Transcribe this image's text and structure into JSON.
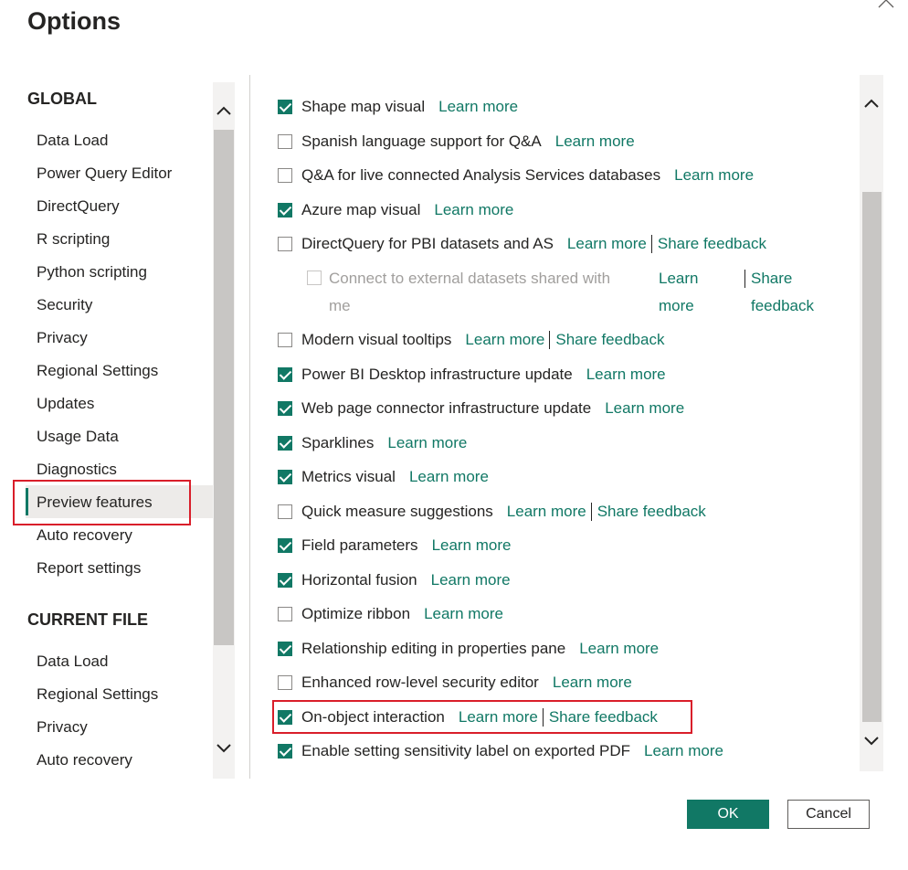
{
  "dialog": {
    "title": "Options"
  },
  "nav": {
    "global_heading": "GLOBAL",
    "global_items": [
      "Data Load",
      "Power Query Editor",
      "DirectQuery",
      "R scripting",
      "Python scripting",
      "Security",
      "Privacy",
      "Regional Settings",
      "Updates",
      "Usage Data",
      "Diagnostics",
      "Preview features",
      "Auto recovery",
      "Report settings"
    ],
    "current_heading": "CURRENT FILE",
    "current_items": [
      "Data Load",
      "Regional Settings",
      "Privacy",
      "Auto recovery"
    ],
    "selected": "Preview features"
  },
  "features": [
    {
      "label": "Shape map visual",
      "checked": true,
      "learn": "Learn more"
    },
    {
      "label": "Spanish language support for Q&A",
      "checked": false,
      "learn": "Learn more"
    },
    {
      "label": "Q&A for live connected Analysis Services databases",
      "checked": false,
      "learn": "Learn more"
    },
    {
      "label": "Azure map visual",
      "checked": true,
      "learn": "Learn more"
    },
    {
      "label": "DirectQuery for PBI datasets and AS",
      "checked": false,
      "learn": "Learn more",
      "feedback": "Share feedback"
    },
    {
      "label": "Modern visual tooltips",
      "checked": false,
      "learn": "Learn more",
      "feedback": "Share feedback"
    },
    {
      "label": "Power BI Desktop infrastructure update",
      "checked": true,
      "learn": "Learn more"
    },
    {
      "label": "Web page connector infrastructure update",
      "checked": true,
      "learn": "Learn more"
    },
    {
      "label": "Sparklines",
      "checked": true,
      "learn": "Learn more"
    },
    {
      "label": "Metrics visual",
      "checked": true,
      "learn": "Learn more"
    },
    {
      "label": "Quick measure suggestions",
      "checked": false,
      "learn": "Learn more",
      "feedback": "Share feedback"
    },
    {
      "label": "Field parameters",
      "checked": true,
      "learn": "Learn more"
    },
    {
      "label": "Horizontal fusion",
      "checked": true,
      "learn": "Learn more"
    },
    {
      "label": "Optimize ribbon",
      "checked": false,
      "learn": "Learn more"
    },
    {
      "label": "Relationship editing in properties pane",
      "checked": true,
      "learn": "Learn more"
    },
    {
      "label": "Enhanced row-level security editor",
      "checked": false,
      "learn": "Learn more"
    },
    {
      "label": "On-object interaction",
      "checked": true,
      "learn": "Learn more",
      "feedback": "Share feedback"
    },
    {
      "label": "Enable setting sensitivity label on exported PDF",
      "checked": true,
      "learn": "Learn more"
    }
  ],
  "sub_option": {
    "label_line1": "Connect to external datasets shared with",
    "label_line2": "me",
    "learn_line1": "Learn",
    "learn_line2": "more",
    "feedback_line1": "Share",
    "feedback_line2": "feedback",
    "checked": false,
    "disabled": true
  },
  "buttons": {
    "ok": "OK",
    "cancel": "Cancel"
  },
  "colors": {
    "accent": "#117865",
    "highlight": "#d91e2a"
  }
}
